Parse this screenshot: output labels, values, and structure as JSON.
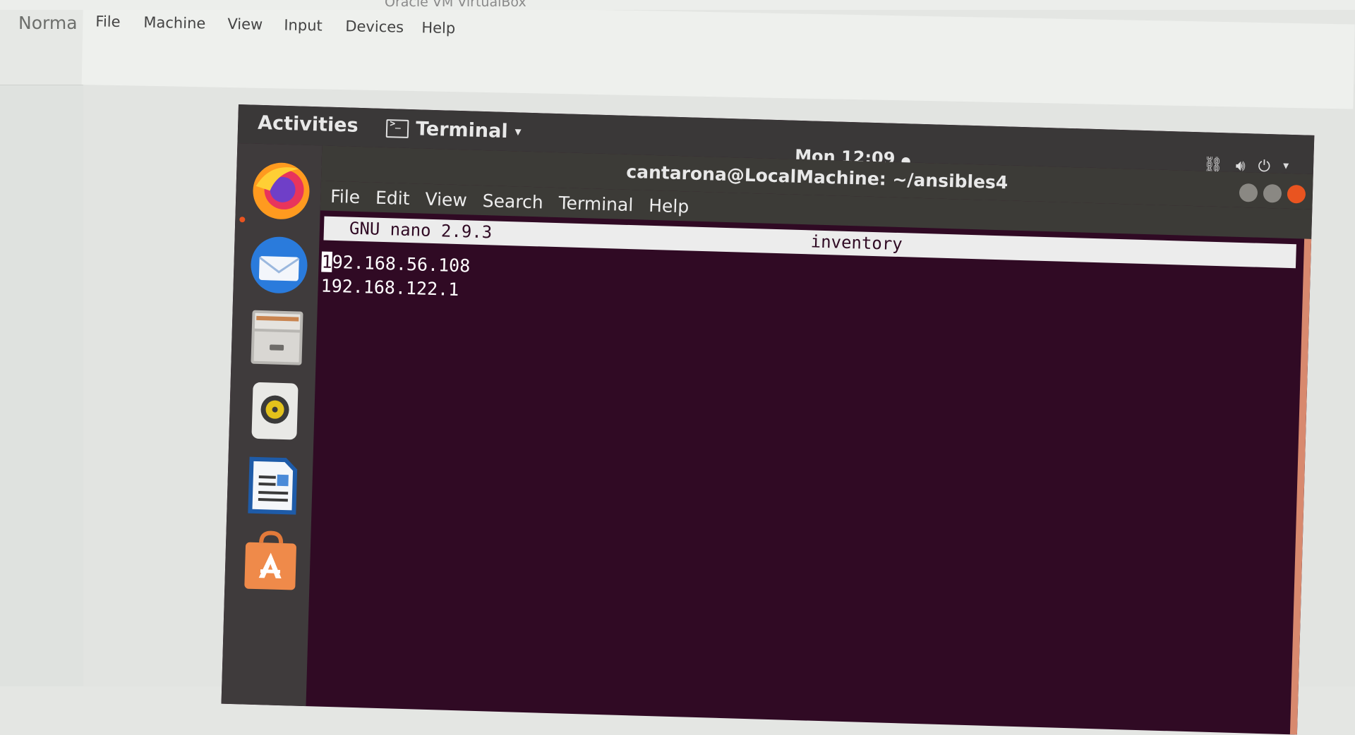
{
  "host": {
    "title": "Oracle VM VirtualBox",
    "left_label": "Norma",
    "menu": [
      "File",
      "Machine",
      "View",
      "Input",
      "Devices",
      "Help"
    ]
  },
  "topbar": {
    "activities": "Activities",
    "app_menu": "Terminal",
    "clock": "Mon 12:09"
  },
  "dock": {
    "apps": [
      "firefox-icon",
      "thunderbird-icon",
      "files-icon",
      "rhythmbox-icon",
      "libreoffice-writer-icon",
      "software-center-icon"
    ]
  },
  "terminal": {
    "title": "cantarona@LocalMachine: ~/ansibles4",
    "menu": [
      "File",
      "Edit",
      "View",
      "Search",
      "Terminal",
      "Help"
    ]
  },
  "nano": {
    "version": "GNU nano 2.9.3",
    "filename": "inventory",
    "first_line_cursor_char": "1",
    "first_line_rest": "92.168.56.108",
    "second_line": "192.168.122.1"
  },
  "colors": {
    "terminal_bg": "#300a24",
    "accent": "#e95420",
    "topbar": "#3a3838",
    "dock": "#3f3b3c"
  }
}
